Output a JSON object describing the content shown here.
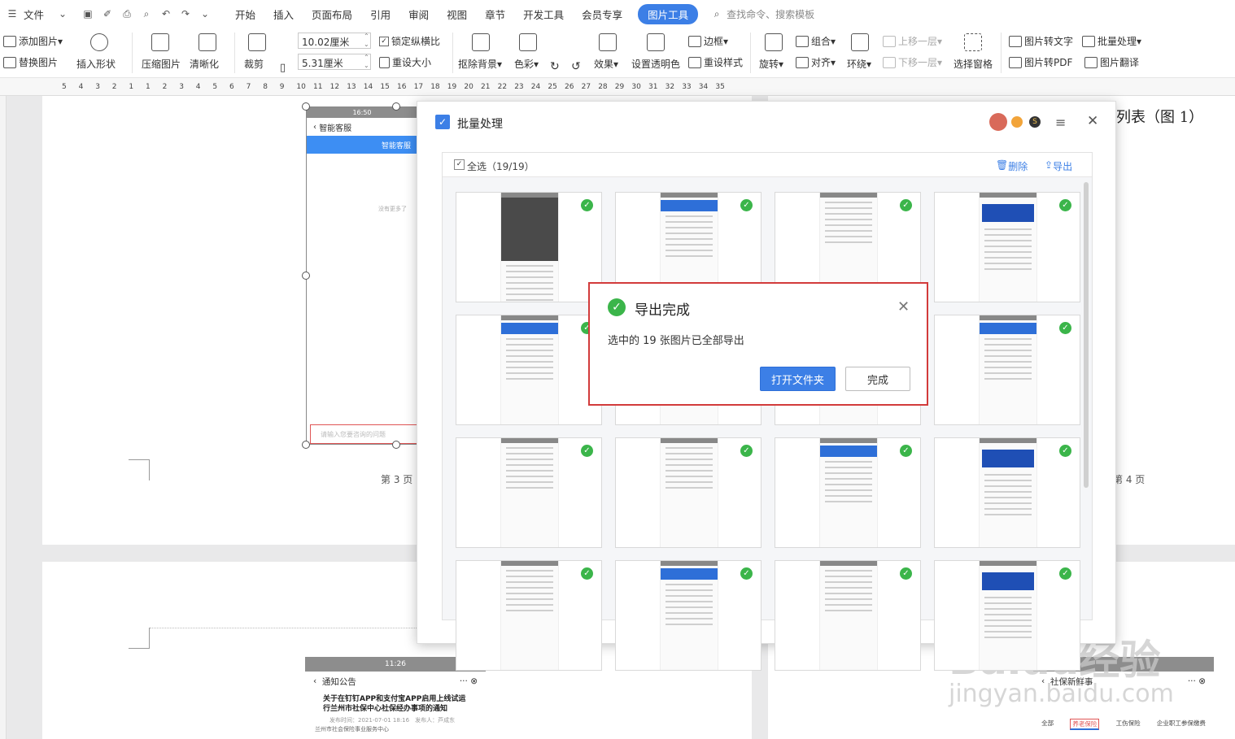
{
  "menubar": {
    "file": "文件",
    "tabs": [
      "开始",
      "插入",
      "页面布局",
      "引用",
      "审阅",
      "视图",
      "章节",
      "开发工具",
      "会员专享"
    ],
    "active_tab": "图片工具",
    "search": "查找命令、搜索模板"
  },
  "ribbon": {
    "add_image": "添加图片",
    "replace_image": "替换图片",
    "insert_shape": "插入形状",
    "compress": "压缩图片",
    "sharpen": "清晰化",
    "crop": "裁剪",
    "width": "10.02厘米",
    "height": "5.31厘米",
    "lock_ratio": "锁定纵横比",
    "reset_size": "重设大小",
    "remove_bg": "抠除背景",
    "color": "色彩",
    "effect": "效果",
    "transparent": "设置透明色",
    "border": "边框",
    "reset_style": "重设样式",
    "rotate": "旋转",
    "group": "组合",
    "align": "对齐",
    "wrap": "环绕",
    "bring_forward": "上移一层",
    "send_backward": "下移一层",
    "select_pane": "选择窗格",
    "img_to_text": "图片转文字",
    "batch": "批量处理",
    "img_to_pdf": "图片转PDF",
    "img_translate": "图片翻译"
  },
  "ruler": [
    "5",
    "4",
    "3",
    "2",
    "1",
    "1",
    "2",
    "3",
    "4",
    "5",
    "6",
    "7",
    "8",
    "9",
    "10",
    "11",
    "12",
    "13",
    "14",
    "15",
    "16",
    "17",
    "18",
    "19",
    "20",
    "21",
    "22",
    "23",
    "24",
    "25",
    "26",
    "27",
    "28",
    "29",
    "30",
    "31",
    "32",
    "33",
    "34",
    "35"
  ],
  "document": {
    "phone_time": "16:50",
    "phone_title": "智能客服",
    "phone_blue_title": "智能客服",
    "phone_nomore": "没有更多了",
    "phone_input": "请输入您要咨询的问题",
    "page3": "第 3 页",
    "page4": "第 4 页",
    "right_heading": "列表（图 1）",
    "bottom_time": "11:26",
    "bottom_title": "通知公告",
    "bottom_headline": "关于在钉钉APP和支付宝APP启用上线试运行兰州市社保中心社保经办事项的通知",
    "bottom_meta": "发布时间：2021-07-01 18:16　发布人：芦成东",
    "bottom_org": "兰州市社会保险事业服务中心",
    "right_title": "社保新鲜事",
    "right_tabs": [
      "全部",
      "养老保险",
      "工伤保险",
      "企业职工参保缴费"
    ],
    "watermark": "Baidu经验",
    "watermark_url": "jingyan.baidu.com"
  },
  "dialog": {
    "title": "批量处理",
    "select_all": "全选（19/19）",
    "delete": "删除",
    "export": "导出",
    "thumb_count": 16
  },
  "popup": {
    "title": "导出完成",
    "message": "选中的 19 张图片已全部导出",
    "open_folder": "打开文件夹",
    "done": "完成"
  }
}
